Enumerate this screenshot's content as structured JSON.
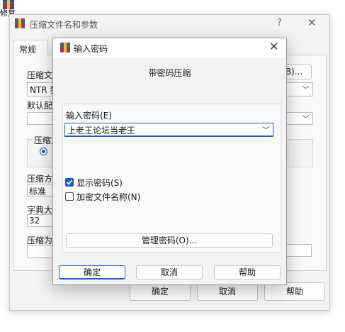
{
  "desktop": {
    "label": "修复"
  },
  "background_dialog": {
    "title": "压缩文件名和参数",
    "help_glyph": "?",
    "close_glyph": "✕",
    "tab_general": "常规",
    "archive_name_label": "压缩文",
    "archive_name_value": "NTR 狂",
    "browse_button_fragment": "B)...",
    "default_profile_label": "默认配",
    "compress_format_label": "压缩文",
    "compress_method_label": "压缩方",
    "compress_method_value": "标准",
    "dictionary_label": "字典大",
    "dictionary_value": "32",
    "split_label": "压缩为",
    "ok_label": "确定",
    "cancel_label": "取消",
    "help_label": "帮助"
  },
  "modal": {
    "title": "输入密码",
    "close_glyph": "✕",
    "heading": "带密码压缩",
    "password_label": "输入密码(E)",
    "password_value": "上老王论坛当老王",
    "dropdown_glyph": "﹀",
    "show_password_label": "显示密码(S)",
    "show_password_checked": true,
    "encrypt_names_label": "加密文件名称(N)",
    "encrypt_names_checked": false,
    "manage_button": "管理密码(O)...",
    "ok_button": "确定",
    "cancel_button": "取消",
    "help_button": "帮助"
  },
  "colors": {
    "accent": "#1f5fbf",
    "window_bg": "#f3f3f3"
  }
}
